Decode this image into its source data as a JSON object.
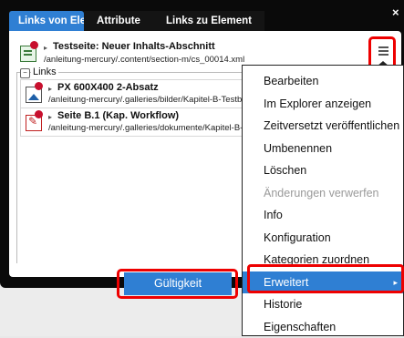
{
  "dialog": {
    "tabs": [
      {
        "label": "Links von Element",
        "active": true
      },
      {
        "label": "Attribute",
        "active": false
      },
      {
        "label": "Links zu Element",
        "active": false
      }
    ],
    "close_label": "×"
  },
  "source": {
    "title": "Testseite: Neuer Inhalts-Abschnitt",
    "path": "/anleitung-mercury/.content/section-m/cs_00014.xml",
    "icon": "content-section-icon"
  },
  "links_section": {
    "label": "Links",
    "collapse_symbol": "−",
    "items": [
      {
        "title": "PX 600X400 2-Absatz",
        "path": "/anleitung-mercury/.galleries/bilder/Kapitel-B-Testbild",
        "icon": "image-icon"
      },
      {
        "title": "Seite B.1 (Kap. Workflow)",
        "path": "/anleitung-mercury/.galleries/dokumente/Kapitel-B-Se",
        "icon": "pdf-icon"
      }
    ]
  },
  "caret_symbol": "▸",
  "context_menu": {
    "items": [
      {
        "label": "Bearbeiten",
        "state": "normal"
      },
      {
        "label": "Im Explorer anzeigen",
        "state": "normal"
      },
      {
        "label": "Zeitversetzt veröffentlichen",
        "state": "normal"
      },
      {
        "label": "Umbenennen",
        "state": "normal"
      },
      {
        "label": "Löschen",
        "state": "normal"
      },
      {
        "label": "Änderungen verwerfen",
        "state": "disabled"
      },
      {
        "label": "Info",
        "state": "normal"
      },
      {
        "label": "Konfiguration",
        "state": "normal"
      },
      {
        "label": "Kategorien zuordnen",
        "state": "normal"
      },
      {
        "label": "Erweitert",
        "state": "highlighted",
        "submenu_arrow": "▸"
      },
      {
        "label": "Historie",
        "state": "normal"
      },
      {
        "label": "Eigenschaften",
        "state": "normal"
      }
    ]
  },
  "footer": {
    "validity_label": "Gültigkeit"
  },
  "colors": {
    "accent": "#2f7fd3",
    "highlight_frame": "#e00000",
    "status_dot": "#c8102e"
  }
}
